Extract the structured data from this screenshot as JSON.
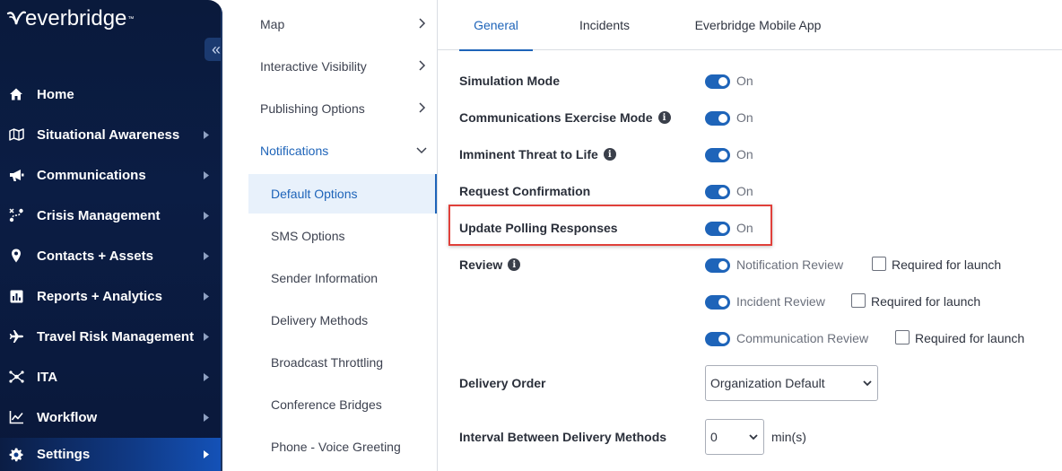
{
  "brand": {
    "logo_text": "everbridge"
  },
  "nav": {
    "collapse_glyph": "«",
    "items": [
      {
        "label": "Home",
        "icon": "home-icon"
      },
      {
        "label": "Situational Awareness",
        "icon": "map-icon"
      },
      {
        "label": "Communications",
        "icon": "megaphone-icon"
      },
      {
        "label": "Crisis Management",
        "icon": "route-icon"
      },
      {
        "label": "Contacts + Assets",
        "icon": "location-pin-icon"
      },
      {
        "label": "Reports + Analytics",
        "icon": "bar-chart-icon"
      },
      {
        "label": "Travel Risk Management",
        "icon": "airplane-icon"
      },
      {
        "label": "ITA",
        "icon": "network-icon"
      },
      {
        "label": "Workflow",
        "icon": "line-chart-icon"
      },
      {
        "label": "Settings",
        "icon": "gear-icon",
        "active": true
      }
    ]
  },
  "submenu": {
    "items": [
      {
        "label": "Map",
        "chevron": "right"
      },
      {
        "label": "Interactive Visibility",
        "chevron": "right"
      },
      {
        "label": "Publishing Options",
        "chevron": "right"
      },
      {
        "label": "Notifications",
        "chevron": "down",
        "expanded": true
      },
      {
        "label": "Default Options",
        "selected": true
      },
      {
        "label": "SMS Options"
      },
      {
        "label": "Sender Information"
      },
      {
        "label": "Delivery Methods"
      },
      {
        "label": "Broadcast Throttling"
      },
      {
        "label": "Conference Bridges"
      },
      {
        "label": "Phone - Voice Greeting"
      }
    ]
  },
  "tabs": [
    {
      "label": "General",
      "active": true
    },
    {
      "label": "Incidents"
    },
    {
      "label": "Everbridge Mobile App"
    }
  ],
  "settings": {
    "simulation_mode": {
      "label": "Simulation Mode",
      "state": "On"
    },
    "comm_exercise_mode": {
      "label": "Communications Exercise Mode",
      "state": "On"
    },
    "imminent_threat": {
      "label": "Imminent Threat to Life",
      "state": "On"
    },
    "request_confirmation": {
      "label": "Request Confirmation",
      "state": "On"
    },
    "update_polling": {
      "label": "Update Polling Responses",
      "state": "On"
    },
    "review": {
      "label": "Review",
      "rows": [
        {
          "toggle_label": "Notification Review",
          "checkbox_label": "Required for launch"
        },
        {
          "toggle_label": "Incident Review",
          "checkbox_label": "Required for launch"
        },
        {
          "toggle_label": "Communication Review",
          "checkbox_label": "Required for launch"
        }
      ]
    },
    "delivery_order": {
      "label": "Delivery Order",
      "value": "Organization Default"
    },
    "interval": {
      "label": "Interval Between Delivery Methods",
      "value": "0",
      "unit": "min(s)"
    }
  },
  "colors": {
    "accent": "#1e64b9",
    "nav_bg": "#0a1a3c",
    "highlight": "#e0403a"
  }
}
